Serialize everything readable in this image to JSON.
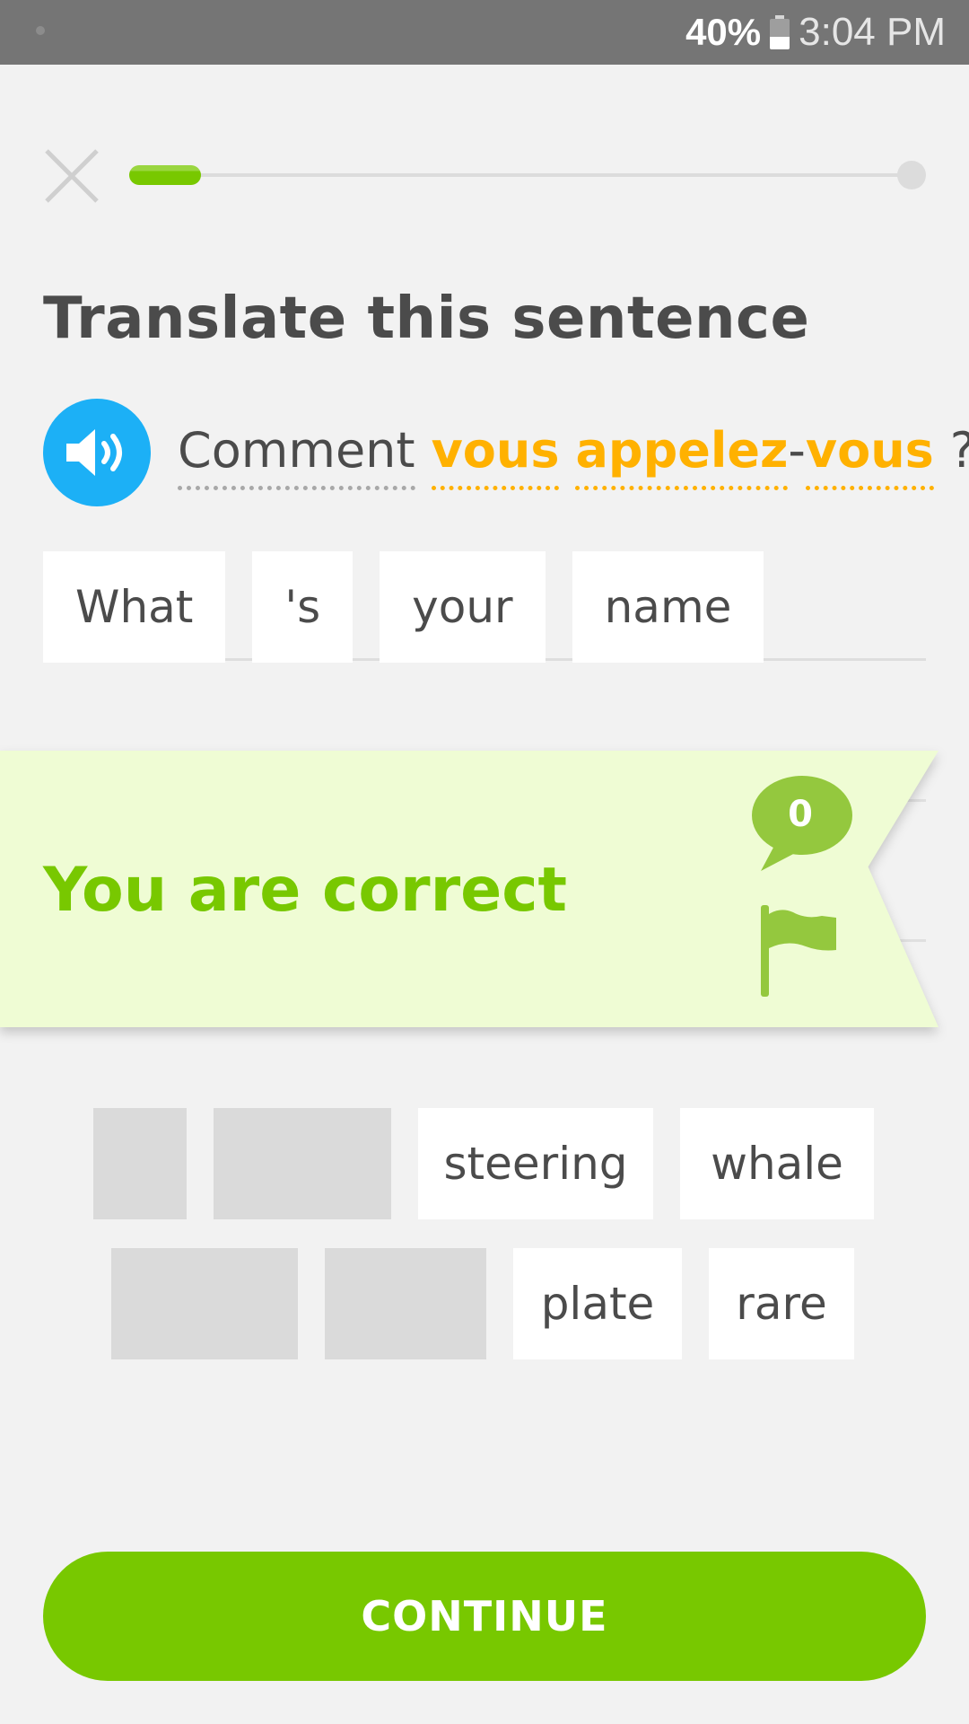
{
  "status_bar": {
    "battery_percent": "40%",
    "battery_level": 0.4,
    "time": "3:04 PM"
  },
  "progress": {
    "fraction": 0.09
  },
  "icons": {
    "close": "close-icon",
    "speaker": "speaker-icon",
    "discuss": "speech-bubble-icon",
    "report": "flag-icon"
  },
  "title": "Translate this sentence",
  "prompt": {
    "comment": "Comment",
    "vous1": "vous",
    "appelez": "appelez",
    "dash": "-",
    "vous2": "vous",
    "question": "?"
  },
  "answer": {
    "words": [
      "What",
      "'s",
      "your",
      "name"
    ]
  },
  "feedback": {
    "title": "You are correct",
    "discussion_count": "0"
  },
  "word_bank": {
    "row1": [
      "steering",
      "whale"
    ],
    "row2": [
      "plate",
      "rare"
    ]
  },
  "continue_label": "CONTINUE",
  "colors": {
    "accent_green": "#78c800",
    "highlight_orange": "#ffb100",
    "speaker_blue": "#1cb0f6",
    "banner_bg": "#effcd4",
    "bubble_green": "#94c83e"
  }
}
